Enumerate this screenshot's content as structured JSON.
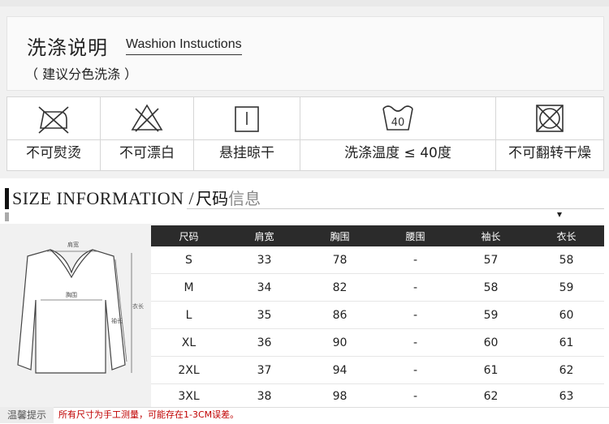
{
  "wash": {
    "title": "洗涤说明",
    "title_en": "Washion Instuctions",
    "subtitle": "（ 建议分色洗涤 ）",
    "care_items": [
      {
        "icon": "no-iron-icon",
        "label": "不可熨烫"
      },
      {
        "icon": "no-bleach-icon",
        "label": "不可漂白"
      },
      {
        "icon": "hang-dry-icon",
        "label": "悬挂晾干"
      },
      {
        "icon": "wash-40-icon",
        "label": "洗涤温度 ≤ 40度",
        "temp": "40"
      },
      {
        "icon": "no-tumble-dry-icon",
        "label": "不可翻转干燥"
      }
    ]
  },
  "size": {
    "title_en": "SIZE INFORMATION /",
    "title_cn_bold": "尺码",
    "title_cn_light": "信息",
    "diagram_labels": {
      "shoulder": "肩宽",
      "bust": "胸围",
      "sleeve": "袖长",
      "length": "衣长"
    },
    "headers": [
      "尺码",
      "肩宽",
      "胸围",
      "腰围",
      "袖长",
      "衣长"
    ],
    "rows": [
      [
        "S",
        "33",
        "78",
        "-",
        "57",
        "58"
      ],
      [
        "M",
        "34",
        "82",
        "-",
        "58",
        "59"
      ],
      [
        "L",
        "35",
        "86",
        "-",
        "59",
        "60"
      ],
      [
        "XL",
        "36",
        "90",
        "-",
        "60",
        "61"
      ],
      [
        "2XL",
        "37",
        "94",
        "-",
        "61",
        "62"
      ],
      [
        "3XL",
        "38",
        "98",
        "-",
        "62",
        "63"
      ]
    ]
  },
  "tip": {
    "label": "温馨提示",
    "text": "所有尺寸为手工测量，可能存在1-3CM误差。"
  },
  "colors": {
    "header_bg": "#2b2b2b",
    "tip_red": "#c00000",
    "panel_gray": "#f1f1f1"
  }
}
